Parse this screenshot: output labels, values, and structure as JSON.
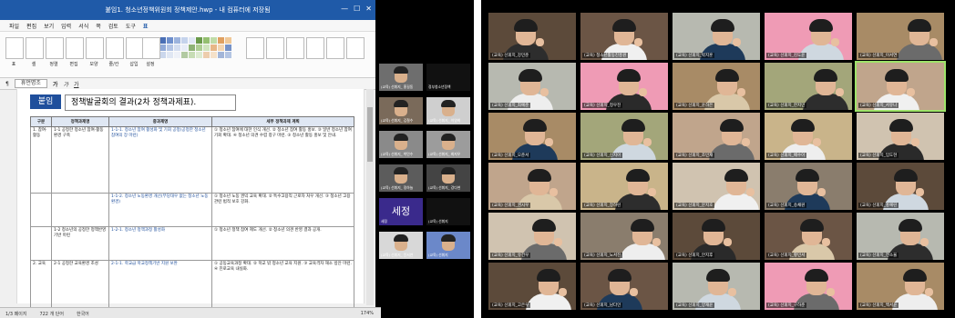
{
  "left_panel": {
    "window_title": "붙임1. 청소년정책위원회 정책제안.hwp - 내 컴퓨터에 저장됨",
    "menu": [
      "파일",
      "편집",
      "보기",
      "입력",
      "서식",
      "쪽",
      "검토",
      "도구",
      "표"
    ],
    "ribbon_labels": [
      "표",
      "셀",
      "정렬",
      "편집",
      "모양",
      "줄/칸",
      "삽입",
      "설정"
    ],
    "font_box": "휴먼명조",
    "doc_tag": "붙임",
    "doc_title": "정책발굴회의 결과(2차 정책과제표).",
    "table_headers": [
      "구분",
      "정책과제명",
      "중과제명",
      "세부 정책과제 계획"
    ],
    "rows": [
      {
        "group": "1. 참여·활동",
        "task": "1-1 공정한 청소년 참여·활동 환경 구축",
        "sub": "1-1-1. 청소년 참여 활성화 및 기회 공정(공정한 청소년 참여의 장 마련)",
        "detail": "① 청소년 참여에 대한 인식 개선. ② 청소년 참여 활동 홍보. ③ 일반 청소년 참여 기회 확대. ④ 청소년 의견 수렴 창구 마련. ⑤ 청소년 활동 홍보 및 안내."
      },
      {
        "group": "",
        "task": "",
        "sub": "1-1-2. 청소년 노동환경 개선(부당대우 없는 청소년 노동환경)",
        "detail": "① 청소년 노동 권익 교육 확대. ② 특수고용직 근로자 처우 개선. ③ 청소년 고용 관련 법적 보호 강화."
      },
      {
        "group": "",
        "task": "1-2 청소년의 공정한 정책반영 기반 마련",
        "sub": "1-2-1. 청소년 정책과정 활성화",
        "detail": "① 청소년 정책 참여 제도 개선. ② 청소년 의견 반영 결과 공개."
      },
      {
        "group": "2. 교육",
        "task": "2-1 공정한 교육환경 조성",
        "sub": "2-1-1. 학교급 학교정책기반 지원 보완",
        "detail": "① 공동교육과정 확대. ② 학교 밖 청소년 교육 지원. ③ 교육격차 해소 방안 마련. ④ 진로교육 내실화."
      }
    ],
    "status": {
      "page": "1/3 페이지",
      "chars": "722 개 단어",
      "lang": "한국어",
      "zoom": "174%"
    },
    "thumbs": [
      "(교육) 선휘지_ 홍길동",
      "정부청소년정책",
      "(교육) 선휘지_ 김철수",
      "(교육) 선휘지_ 이영희",
      "(교육) 선휘지_ 박민수",
      "(교육) 선휘지_ 최지우",
      "(교육) 선휘지_ 정하늘",
      "(교육) 선휘지_ 강다현",
      "세정",
      "(교육) 선휘지",
      "(교육) 선휘지_ 윤서연",
      "(교육) 선휘지"
    ],
    "big_tile_text": "세정"
  },
  "right_panel": {
    "participants": [
      "(교육) 선휘지_강민준",
      "(교육) 청소년활동진흥원",
      "(교육) 선휘지_박지훈",
      "(교육) 선휘지_김도윤",
      "(교육) 선휘지_이서연",
      "(교육) 선휘지_최예준",
      "(교육) 선휘지_정우진",
      "(교육) 선휘지_윤하은",
      "(교육) 선휘지_한지민",
      "(교육) 선휘지_서유나",
      "(교육) 선휘지_오준서",
      "(교육) 선휘지_신지아",
      "(교육) 선휘지_조민재",
      "(교육) 선휘지_배수아",
      "(교육) 선휘지_임도현",
      "(교육) 선휘지_권시우",
      "(교육) 선휘지_장하린",
      "(교육) 선휘지_문지호",
      "(교육) 선휘지_송채원",
      "(교육) 선휘지_홍예린",
      "(교육) 선휘지_유건우",
      "(교육) 선휘지_노서진",
      "(교육) 선휘지_안지후",
      "(교육) 선휘지_황민서",
      "(교육) 선휘지_전소율",
      "(교육) 선휘지_고은우",
      "(교육) 선휘지_남다인",
      "(교육) 선휘지_양재윤",
      "(교육) 선휘지_구하준",
      "(교육) 선휘지_백서윤"
    ],
    "colors": [
      "#5c4a3a",
      "#c9b48a",
      "#a88b66",
      "#6b5545",
      "#d0c3b0",
      "#a3a67a",
      "#b7b9b0",
      "#8a7d6d",
      "#c0a58c",
      "#ef9bb5"
    ]
  }
}
